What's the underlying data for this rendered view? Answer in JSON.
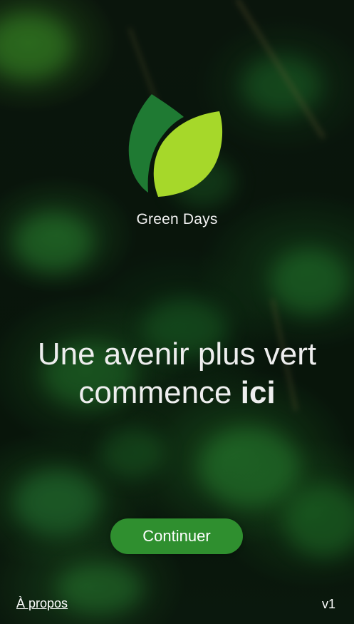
{
  "brand": {
    "name": "Green Days",
    "logo_icon": "leaf-logo-icon",
    "colors": {
      "dark_leaf": "#1f7a33",
      "light_leaf": "#a6d82a"
    }
  },
  "headline": {
    "prefix": "Une avenir plus vert commence ",
    "emphasis": "ici"
  },
  "cta": {
    "label": "Continuer",
    "color": "#2f8f2f"
  },
  "footer": {
    "about_label": "À propos",
    "version": "v1"
  }
}
